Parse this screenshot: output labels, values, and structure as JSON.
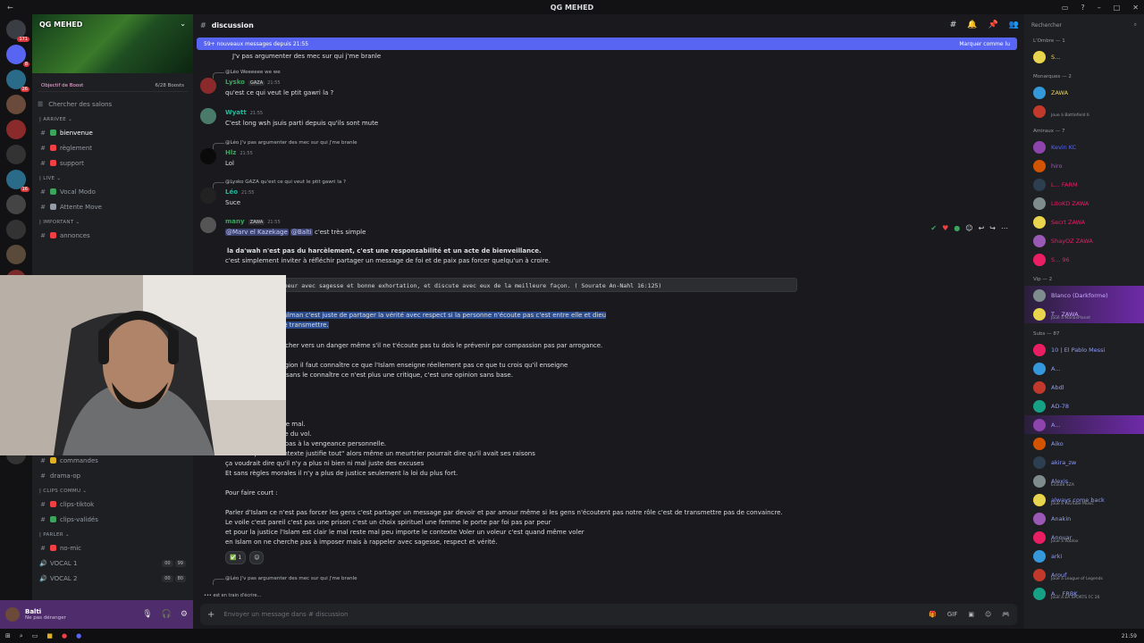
{
  "window": {
    "title": "QG MEHED",
    "back": "←"
  },
  "server": {
    "name": "QG MEHED",
    "boost_label": "Objectif de Boost",
    "boost_count": "6/28 Boosts",
    "search_label": "Chercher des salons"
  },
  "rail_badges": [
    "171",
    "8",
    "26",
    "",
    "",
    "",
    "16",
    "",
    "",
    "",
    "964"
  ],
  "categories": [
    {
      "title": "| ARRIVEE ⌄",
      "channels": [
        {
          "label": "bienvenue",
          "active": true,
          "color": "#3ba55c"
        },
        {
          "label": "règlement",
          "active": false,
          "color": "#f23f43"
        },
        {
          "label": "support",
          "active": false,
          "color": "#f23f43"
        }
      ]
    },
    {
      "title": "| LIVE ⌄",
      "channels": [
        {
          "label": "Vocal Modo",
          "active": false,
          "color": "#3ba55c"
        },
        {
          "label": "Attente Move",
          "active": false,
          "color": "#949ba4"
        }
      ]
    },
    {
      "title": "| IMPORTANT ⌄",
      "channels": [
        {
          "label": "annonces",
          "active": false,
          "color": "#f23f43"
        }
      ]
    }
  ],
  "lower_channels": [
    {
      "label": "commandes",
      "color": "#e0b020"
    },
    {
      "label": "drama-op",
      "color": "#949ba4"
    }
  ],
  "clips_cat": "| CLIPS COMMU ⌄",
  "clips": [
    {
      "label": "clips-tiktok",
      "color": "#f23f43"
    },
    {
      "label": "clips-validés",
      "color": "#3ba55c"
    }
  ],
  "parler_cat": "| PARLER ⌄",
  "parler": [
    {
      "label": "no-mic",
      "count": "",
      "count2": ""
    },
    {
      "label": "VOCAL 1",
      "count": "00",
      "count2": "99"
    },
    {
      "label": "VOCAL 2",
      "count": "00",
      "count2": "80"
    }
  ],
  "user": {
    "name": "Balti",
    "status": "Ne pas déranger"
  },
  "channel": {
    "name": "discussion"
  },
  "newbar": {
    "text": "59+ nouveaux messages depuis 21:55",
    "mark": "Marquer comme lu"
  },
  "messages": {
    "m0": "J'v pas argumenter des mec sur qui j'me branle",
    "r1": "@Léo Weeeeee we we",
    "lysko": {
      "name": "Lysko",
      "tag": "GAZA",
      "time": "21:55",
      "text": "qu'est ce qui veut le ptit gawri la ?"
    },
    "wyatt": {
      "name": "Wyatt",
      "time": "21:55",
      "text": "C'est long wsh jsuis parti depuis qu'ils sont mute"
    },
    "r2": "@Léo J'v pas argumenter des mec sur qui j'me branle",
    "hlz": {
      "name": "Hlz",
      "time": "21:55",
      "text": "Lol"
    },
    "r3": "@Lysko GAZA qu'est ce qui veut le ptit gawri la ?",
    "leo": {
      "name": "Léo",
      "time": "21:55",
      "text": "Suce"
    },
    "many": {
      "name": "many",
      "tag": "ZAWA",
      "time": "21:55",
      "mention1": "@Marv el Kazekage",
      "mention2": "@Balti",
      "text": "c'est très simple"
    },
    "p1": "la da'wah n'est pas du harcèlement, c'est une responsabilité et un acte de bienveillance.",
    "p2": "c'est simplement inviter à réfléchir partager un message de foi et de paix pas forcer quelqu'un à croire.",
    "code": "ier de ton Seigneur avec sagesse et bonne exhortation, et discute avec eux de la meilleure façon. ( Sourate An-Nahl 16:125)",
    "h1": "en temps que musulman c'est juste de partager la vérité avec respect si la personne n'écoute pas c'est entre elle et dieu",
    "h2": "r fait mon devoir de transmettre.",
    "p3": "yais quelqu'un marcher vers un danger même s'il ne t'écoute pas tu dois le prévenir par compassion pas par arrogance.",
    "p4": "usulman sur sa religion il faut connaître ce que l'Islam enseigne réellement pas ce que tu crois qu'il enseigne",
    "p5": "un parle d'un sujet sans le connaître ce n'est plus une critique, c'est une opinion sans base.",
    "p6": "nd pas au mal par le mal.",
    "p7": "qu'il a volé, ça reste du vol.",
    "p8": "t à Dieu et à la loi, pas à la vengeance personnelle.",
    "p9": "si on dit que \"le contexte justifie tout\" alors même un meurtrier pourrait dire qu'il avait ses raisons",
    "p10": "ça voudrait dire qu'il n'y a plus ni bien ni mal juste des excuses",
    "p11": "Et sans règles morales il n'y a plus de justice  seulement la loi du plus fort.",
    "p12": "Pour faire court :",
    "p13": "Parler d'Islam ce n'est pas forcer les gens c'est partager un message par devoir et par amour même si les gens n'écoutent pas notre rôle c'est de transmettre  pas de convaincre.",
    "p14": "Le voile c'est pareil  c'est pas une prison c'est un choix spirituel une femme le porte par foi pas par peur",
    "p15": "et pour la justice l'Islam est clair le mal reste mal peu importe le contexte Voler un voleur c'est quand même voler",
    "p16": "en Islam on ne cherche pas à imposer mais à rappeler avec sagesse, respect et vérité.",
    "reaction": "✅ 1",
    "r4": "@Léo J'v pas argumenter des mec sur qui j'me branle",
    "typing": "est en train d'écrire..."
  },
  "input": {
    "placeholder": "Envoyer un message dans #  discussion"
  },
  "members": {
    "search": "Rechercher",
    "groups": [
      {
        "title": "L'Ombre — 1",
        "list": [
          {
            "name": "S...",
            "color": "#e8d44d",
            "act": "",
            "hl": false
          }
        ]
      },
      {
        "title": "Monarques — 2",
        "list": [
          {
            "name": "ZAWA",
            "color": "#e8d44d",
            "act": "",
            "hl": false
          },
          {
            "name": "",
            "color": "#e8d44d",
            "act": "Joue à Battlefield 6",
            "hl": false
          }
        ]
      },
      {
        "title": "Amiraux — 7",
        "list": [
          {
            "name": "Kevin  KC",
            "color": "#5865f2",
            "act": "",
            "hl": false
          },
          {
            "name": "hiro",
            "color": "#9b59b6",
            "act": "",
            "hl": false
          },
          {
            "name": "L...  FARM",
            "color": "#e91e63",
            "act": "",
            "hl": false
          },
          {
            "name": "LitoKD  ZAWA",
            "color": "#e91e63",
            "act": "",
            "hl": false
          },
          {
            "name": "Secrt  ZAWA",
            "color": "#e91e63",
            "act": "",
            "hl": false
          },
          {
            "name": "ShayOZ  ZAWA",
            "color": "#e91e63",
            "act": "",
            "hl": false
          },
          {
            "name": "S...  96",
            "color": "#e91e63",
            "act": "",
            "hl": false
          }
        ]
      },
      {
        "title": "Vip — 2",
        "list": [
          {
            "name": "Blanco (Darkforme)",
            "color": "#c9a8ff",
            "act": "",
            "hl": true
          },
          {
            "name": "T...  ZAWA",
            "color": "#c9a8ff",
            "act": "Joue à ManasPlanet",
            "hl": true
          }
        ]
      },
      {
        "title": "Subs — 87",
        "list": [
          {
            "name": "10 | El Pablo Messi",
            "color": "#8f9bff",
            "act": "",
            "hl": false
          },
          {
            "name": "A...",
            "color": "#8f9bff",
            "act": "",
            "hl": false
          },
          {
            "name": "Abdl",
            "color": "#8f9bff",
            "act": "",
            "hl": false
          },
          {
            "name": "AD-78",
            "color": "#8f9bff",
            "act": "",
            "hl": false
          },
          {
            "name": "A...",
            "color": "#8f9bff",
            "act": "",
            "hl": true
          },
          {
            "name": "Aiko",
            "color": "#8f9bff",
            "act": "",
            "hl": false
          },
          {
            "name": "akira_zw",
            "color": "#8f9bff",
            "act": "",
            "hl": false
          },
          {
            "name": "Alexis",
            "color": "#8f9bff",
            "act": "Écoute SZA",
            "hl": false
          },
          {
            "name": "always come back",
            "color": "#8f9bff",
            "act": "Joue à YouTube Music",
            "hl": false
          },
          {
            "name": "Anakin",
            "color": "#8f9bff",
            "act": "",
            "hl": false
          },
          {
            "name": "Anouar",
            "color": "#8f9bff",
            "act": "Joue à Roblox",
            "hl": false
          },
          {
            "name": "arki",
            "color": "#8f9bff",
            "act": "",
            "hl": false
          },
          {
            "name": "Arouf",
            "color": "#8f9bff",
            "act": "Joue à League of Legends",
            "hl": false
          },
          {
            "name": "A...  FRBK",
            "color": "#8f9bff",
            "act": "Joue à EA SPORTS FC 26",
            "hl": false
          }
        ]
      }
    ]
  },
  "taskbar": {
    "time": "21:59"
  }
}
